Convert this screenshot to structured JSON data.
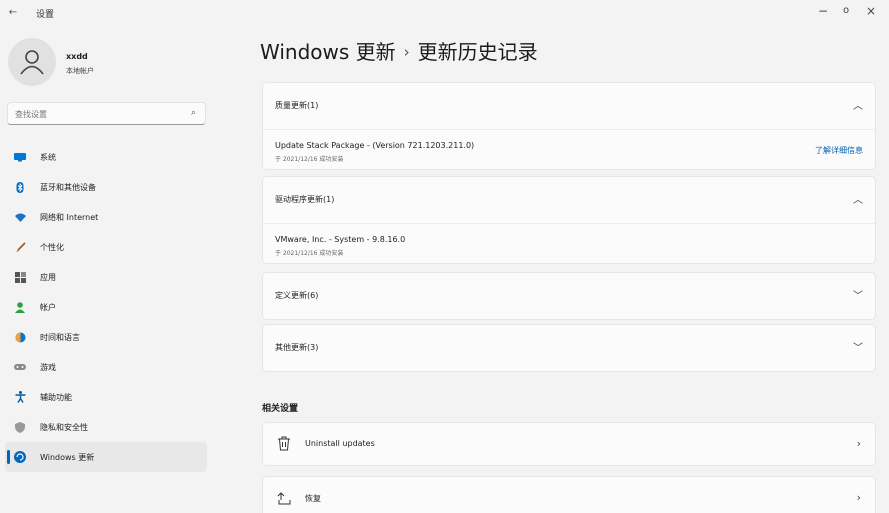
{
  "window": {
    "title": "设置",
    "back": "←",
    "minimize": "−",
    "maximize": "o",
    "close": "×"
  },
  "profile": {
    "name": "xxdd",
    "account_type": "本地帐户"
  },
  "search": {
    "placeholder": "查找设置",
    "icon": "search-icon"
  },
  "sidebar": {
    "items": [
      {
        "label": "系统",
        "icon": "display-icon",
        "color": "#0078d4"
      },
      {
        "label": "蓝牙和其他设备",
        "icon": "bluetooth-icon",
        "color": "#0067c0"
      },
      {
        "label": "网络和 Internet",
        "icon": "wifi-icon",
        "color": "#1a73c9"
      },
      {
        "label": "个性化",
        "icon": "brush-icon",
        "color": "#a0522d"
      },
      {
        "label": "应用",
        "icon": "apps-icon",
        "color": "#555555"
      },
      {
        "label": "帐户",
        "icon": "account-icon",
        "color": "#2ea043"
      },
      {
        "label": "时间和语言",
        "icon": "clock-globe-icon",
        "color": "#0078d4"
      },
      {
        "label": "游戏",
        "icon": "gamepad-icon",
        "color": "#777777"
      },
      {
        "label": "辅助功能",
        "icon": "accessibility-icon",
        "color": "#005a9e"
      },
      {
        "label": "隐私和安全性",
        "icon": "shield-icon",
        "color": "#8a8a8a"
      },
      {
        "label": "Windows 更新",
        "icon": "windows-update-icon",
        "color": "#0067c0",
        "active": true
      }
    ]
  },
  "breadcrumb": {
    "parent": "Windows 更新",
    "separator": "›",
    "current": "更新历史记录"
  },
  "groups": [
    {
      "title": "质量更新(1)",
      "expanded": true,
      "entries": [
        {
          "name": "Update Stack Package - (Version 721.1203.211.0)",
          "status": "于 2021/12/16 成功安装",
          "link": "了解详细信息"
        }
      ]
    },
    {
      "title": "驱动程序更新(1)",
      "expanded": true,
      "entries": [
        {
          "name": "VMware, Inc. - System - 9.8.16.0",
          "status": "于 2021/12/16 成功安装"
        }
      ]
    },
    {
      "title": "定义更新(6)",
      "expanded": false,
      "entries": []
    },
    {
      "title": "其他更新(3)",
      "expanded": false,
      "entries": []
    }
  ],
  "related": {
    "heading": "相关设置",
    "items": [
      {
        "label": "Uninstall updates",
        "icon": "trash-icon"
      },
      {
        "label": "恢复",
        "icon": "recovery-icon"
      }
    ]
  },
  "colors": {
    "accent": "#0067c0",
    "link": "#005fb8",
    "background": "#f3f3f3",
    "card": "#fbfbfb"
  }
}
